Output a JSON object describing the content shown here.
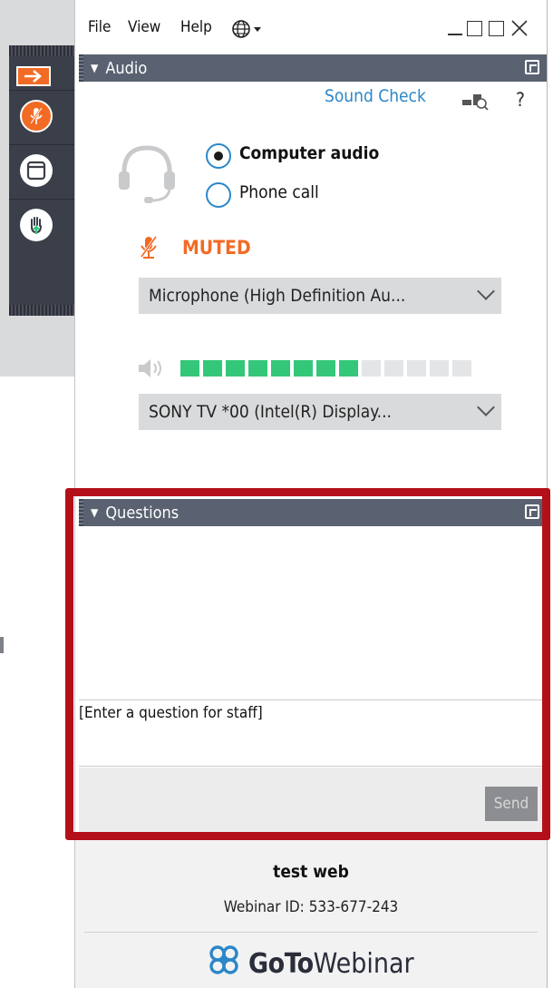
{
  "menu": {
    "file": "File",
    "view": "View",
    "help": "Help",
    "language_icon": "globe-icon"
  },
  "audio_panel": {
    "title": "Audio",
    "sound_check": "Sound Check",
    "help": "?",
    "computer_audio": "Computer audio",
    "phone_call": "Phone call",
    "selected_mode": "Computer audio",
    "mute_status": "MUTED",
    "microphone": "Microphone (High Definition Au...",
    "speaker": "SONY TV  *00 (Intel(R) Display...",
    "speaker_level_segments_lit": 8,
    "speaker_level_segments_total": 13
  },
  "questions_panel": {
    "title": "Questions",
    "input_placeholder": "[Enter a question for staff]",
    "send": "Send"
  },
  "footer": {
    "session_name": "test web",
    "webinar_id": "Webinar ID: 533-677-243",
    "brand_bold": "GoTo",
    "brand_light": "Webinar"
  },
  "colors": {
    "accent_orange": "#f26b24",
    "link_blue": "#2b87c8",
    "meter_green": "#34c77a",
    "panel_header": "#5a6170",
    "highlight_red": "#b4101a"
  }
}
